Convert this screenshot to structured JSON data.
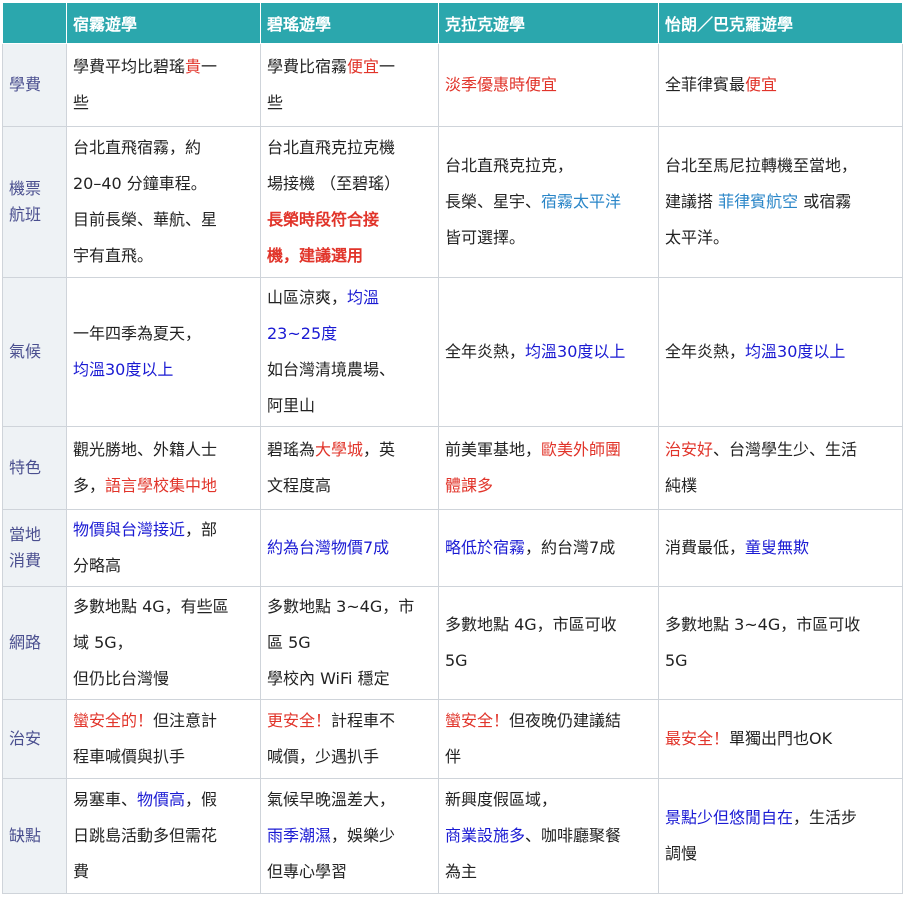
{
  "headers": [
    "",
    "宿霧遊學",
    "碧瑤遊學",
    "克拉克遊學",
    "怡朗／巴克羅遊學"
  ],
  "rows": [
    {
      "label": [
        "學費"
      ],
      "cells": [
        [
          [
            {
              "t": "學費平均比碧瑤",
              "c": "blk"
            },
            {
              "t": "貴",
              "c": "red"
            },
            {
              "t": "一",
              "c": "blk"
            }
          ],
          [
            {
              "t": "些",
              "c": "blk"
            }
          ]
        ],
        [
          [
            {
              "t": "學費比宿霧",
              "c": "blk"
            },
            {
              "t": "便宜",
              "c": "red"
            },
            {
              "t": "一",
              "c": "blk"
            }
          ],
          [
            {
              "t": "些",
              "c": "blk"
            }
          ]
        ],
        [
          [
            {
              "t": "淡季優惠時便宜",
              "c": "red"
            }
          ]
        ],
        [
          [
            {
              "t": "全菲律賓最",
              "c": "blk"
            },
            {
              "t": "便宜",
              "c": "red"
            }
          ]
        ]
      ]
    },
    {
      "label": [
        "機票",
        "航班"
      ],
      "cells": [
        [
          [
            {
              "t": "台北直飛宿霧，約",
              "c": "blk"
            }
          ],
          [
            {
              "t": "20–40 分鐘車程。",
              "c": "blk"
            }
          ],
          [
            {
              "t": "目前長榮、華航、星",
              "c": "blk"
            }
          ],
          [
            {
              "t": "宇有直飛。",
              "c": "blk"
            }
          ]
        ],
        [
          [
            {
              "t": "台北直飛克拉克機",
              "c": "blk"
            }
          ],
          [
            {
              "t": "場接機 （至碧瑤）",
              "c": "blk"
            }
          ],
          [
            {
              "t": "長榮時段符合接",
              "c": "bred"
            }
          ],
          [
            {
              "t": "機，建議選用",
              "c": "bred"
            }
          ]
        ],
        [
          [
            {
              "t": "台北直飛克拉克，",
              "c": "blk"
            }
          ],
          [
            {
              "t": "長榮、星宇、",
              "c": "blk"
            },
            {
              "t": "宿霧太平洋",
              "c": "lblue"
            }
          ],
          [
            {
              "t": "皆可選擇。",
              "c": "blk"
            }
          ]
        ],
        [
          [
            {
              "t": "台北至馬尼拉轉機至當地，",
              "c": "blk"
            }
          ],
          [
            {
              "t": "建議搭 ",
              "c": "blk"
            },
            {
              "t": "菲律賓航空",
              "c": "lblue"
            },
            {
              "t": " 或宿霧",
              "c": "blk"
            }
          ],
          [
            {
              "t": "太平洋。",
              "c": "blk"
            }
          ]
        ]
      ]
    },
    {
      "label": [
        "氣候"
      ],
      "cells": [
        [
          [
            {
              "t": "一年四季為夏天，",
              "c": "blk"
            }
          ],
          [
            {
              "t": "均溫30度以上",
              "c": "blue"
            }
          ]
        ],
        [
          [
            {
              "t": "山區涼爽，",
              "c": "blk"
            },
            {
              "t": "均溫",
              "c": "blue"
            }
          ],
          [
            {
              "t": "23~25度",
              "c": "blue"
            }
          ],
          [
            {
              "t": "如台灣清境農場、",
              "c": "blk"
            }
          ],
          [
            {
              "t": "阿里山",
              "c": "blk"
            }
          ]
        ],
        [
          [
            {
              "t": "全年炎熱，",
              "c": "blk"
            },
            {
              "t": "均溫30度以上",
              "c": "blue"
            }
          ]
        ],
        [
          [
            {
              "t": "全年炎熱，",
              "c": "blk"
            },
            {
              "t": "均溫30度以上",
              "c": "blue"
            }
          ]
        ]
      ]
    },
    {
      "label": [
        "特色"
      ],
      "cells": [
        [
          [
            {
              "t": "觀光勝地、外籍人士",
              "c": "blk"
            }
          ],
          [
            {
              "t": "多，",
              "c": "blk"
            },
            {
              "t": "語言學校集中地",
              "c": "red"
            }
          ]
        ],
        [
          [
            {
              "t": "碧瑤為",
              "c": "blk"
            },
            {
              "t": "大學城",
              "c": "red"
            },
            {
              "t": "，英",
              "c": "blk"
            }
          ],
          [
            {
              "t": "文程度高",
              "c": "blk"
            }
          ]
        ],
        [
          [
            {
              "t": "前美軍基地，",
              "c": "blk"
            },
            {
              "t": "歐美外師團",
              "c": "red"
            }
          ],
          [
            {
              "t": "體課多",
              "c": "red"
            }
          ]
        ],
        [
          [
            {
              "t": "治安好",
              "c": "red"
            },
            {
              "t": "、台灣學生少、生活",
              "c": "blk"
            }
          ],
          [
            {
              "t": "純樸",
              "c": "blk"
            }
          ]
        ]
      ]
    },
    {
      "label": [
        "當地",
        "消費"
      ],
      "cells": [
        [
          [
            {
              "t": "物價與台灣接近",
              "c": "blue"
            },
            {
              "t": "，部",
              "c": "blk"
            }
          ],
          [
            {
              "t": "分略高",
              "c": "blk"
            }
          ]
        ],
        [
          [
            {
              "t": "約為台灣物價7成",
              "c": "blue"
            }
          ]
        ],
        [
          [
            {
              "t": "略低於宿霧",
              "c": "blue"
            },
            {
              "t": "，約台灣7成",
              "c": "blk"
            }
          ]
        ],
        [
          [
            {
              "t": "消費最低，",
              "c": "blk"
            },
            {
              "t": "童叟無欺",
              "c": "blue"
            }
          ]
        ]
      ]
    },
    {
      "label": [
        "網路"
      ],
      "cells": [
        [
          [
            {
              "t": "多數地點 4G，有些區",
              "c": "blk"
            }
          ],
          [
            {
              "t": "域 5G，",
              "c": "blk"
            }
          ],
          [
            {
              "t": "但仍比台灣慢",
              "c": "blk"
            }
          ]
        ],
        [
          [
            {
              "t": "多數地點 3~4G，市",
              "c": "blk"
            }
          ],
          [
            {
              "t": "區 5G",
              "c": "blk"
            }
          ],
          [
            {
              "t": "學校內 WiFi 穩定",
              "c": "blk"
            }
          ]
        ],
        [
          [
            {
              "t": "多數地點 4G，市區可收",
              "c": "blk"
            }
          ],
          [
            {
              "t": "5G",
              "c": "blk"
            }
          ]
        ],
        [
          [
            {
              "t": "多數地點 3~4G，市區可收",
              "c": "blk"
            }
          ],
          [
            {
              "t": "5G",
              "c": "blk"
            }
          ]
        ]
      ]
    },
    {
      "label": [
        "治安"
      ],
      "cells": [
        [
          [
            {
              "t": "蠻安全的！",
              "c": "red"
            },
            {
              "t": "但注意計",
              "c": "blk"
            }
          ],
          [
            {
              "t": "程車喊價與扒手",
              "c": "blk"
            }
          ]
        ],
        [
          [
            {
              "t": "更安全！",
              "c": "red"
            },
            {
              "t": "計程車不",
              "c": "blk"
            }
          ],
          [
            {
              "t": "喊價，少遇扒手",
              "c": "blk"
            }
          ]
        ],
        [
          [
            {
              "t": "蠻安全！",
              "c": "red"
            },
            {
              "t": "但夜晚仍建議結",
              "c": "blk"
            }
          ],
          [
            {
              "t": "伴",
              "c": "blk"
            }
          ]
        ],
        [
          [
            {
              "t": "最安全！",
              "c": "red"
            },
            {
              "t": "單獨出門也OK",
              "c": "blk"
            }
          ]
        ]
      ]
    },
    {
      "label": [
        "缺點"
      ],
      "cells": [
        [
          [
            {
              "t": "易塞車、",
              "c": "blk"
            },
            {
              "t": "物價高",
              "c": "blue"
            },
            {
              "t": "，假",
              "c": "blk"
            }
          ],
          [
            {
              "t": "日跳島活動多但需花",
              "c": "blk"
            }
          ],
          [
            {
              "t": "費",
              "c": "blk"
            }
          ]
        ],
        [
          [
            {
              "t": "氣候早晚溫差大，",
              "c": "blk"
            }
          ],
          [
            {
              "t": "雨季潮濕",
              "c": "blue"
            },
            {
              "t": "，娛樂少",
              "c": "blk"
            }
          ],
          [
            {
              "t": "但專心學習",
              "c": "blk"
            }
          ]
        ],
        [
          [
            {
              "t": "新興度假區域，",
              "c": "blk"
            }
          ],
          [
            {
              "t": "商業設施多",
              "c": "blue"
            },
            {
              "t": "、咖啡廳聚餐",
              "c": "blk"
            }
          ],
          [
            {
              "t": "為主",
              "c": "blk"
            }
          ]
        ],
        [
          [
            {
              "t": "景點少但悠閒自在",
              "c": "blue"
            },
            {
              "t": "，生活步",
              "c": "blk"
            }
          ],
          [
            {
              "t": "調慢",
              "c": "blk"
            }
          ]
        ]
      ]
    }
  ]
}
